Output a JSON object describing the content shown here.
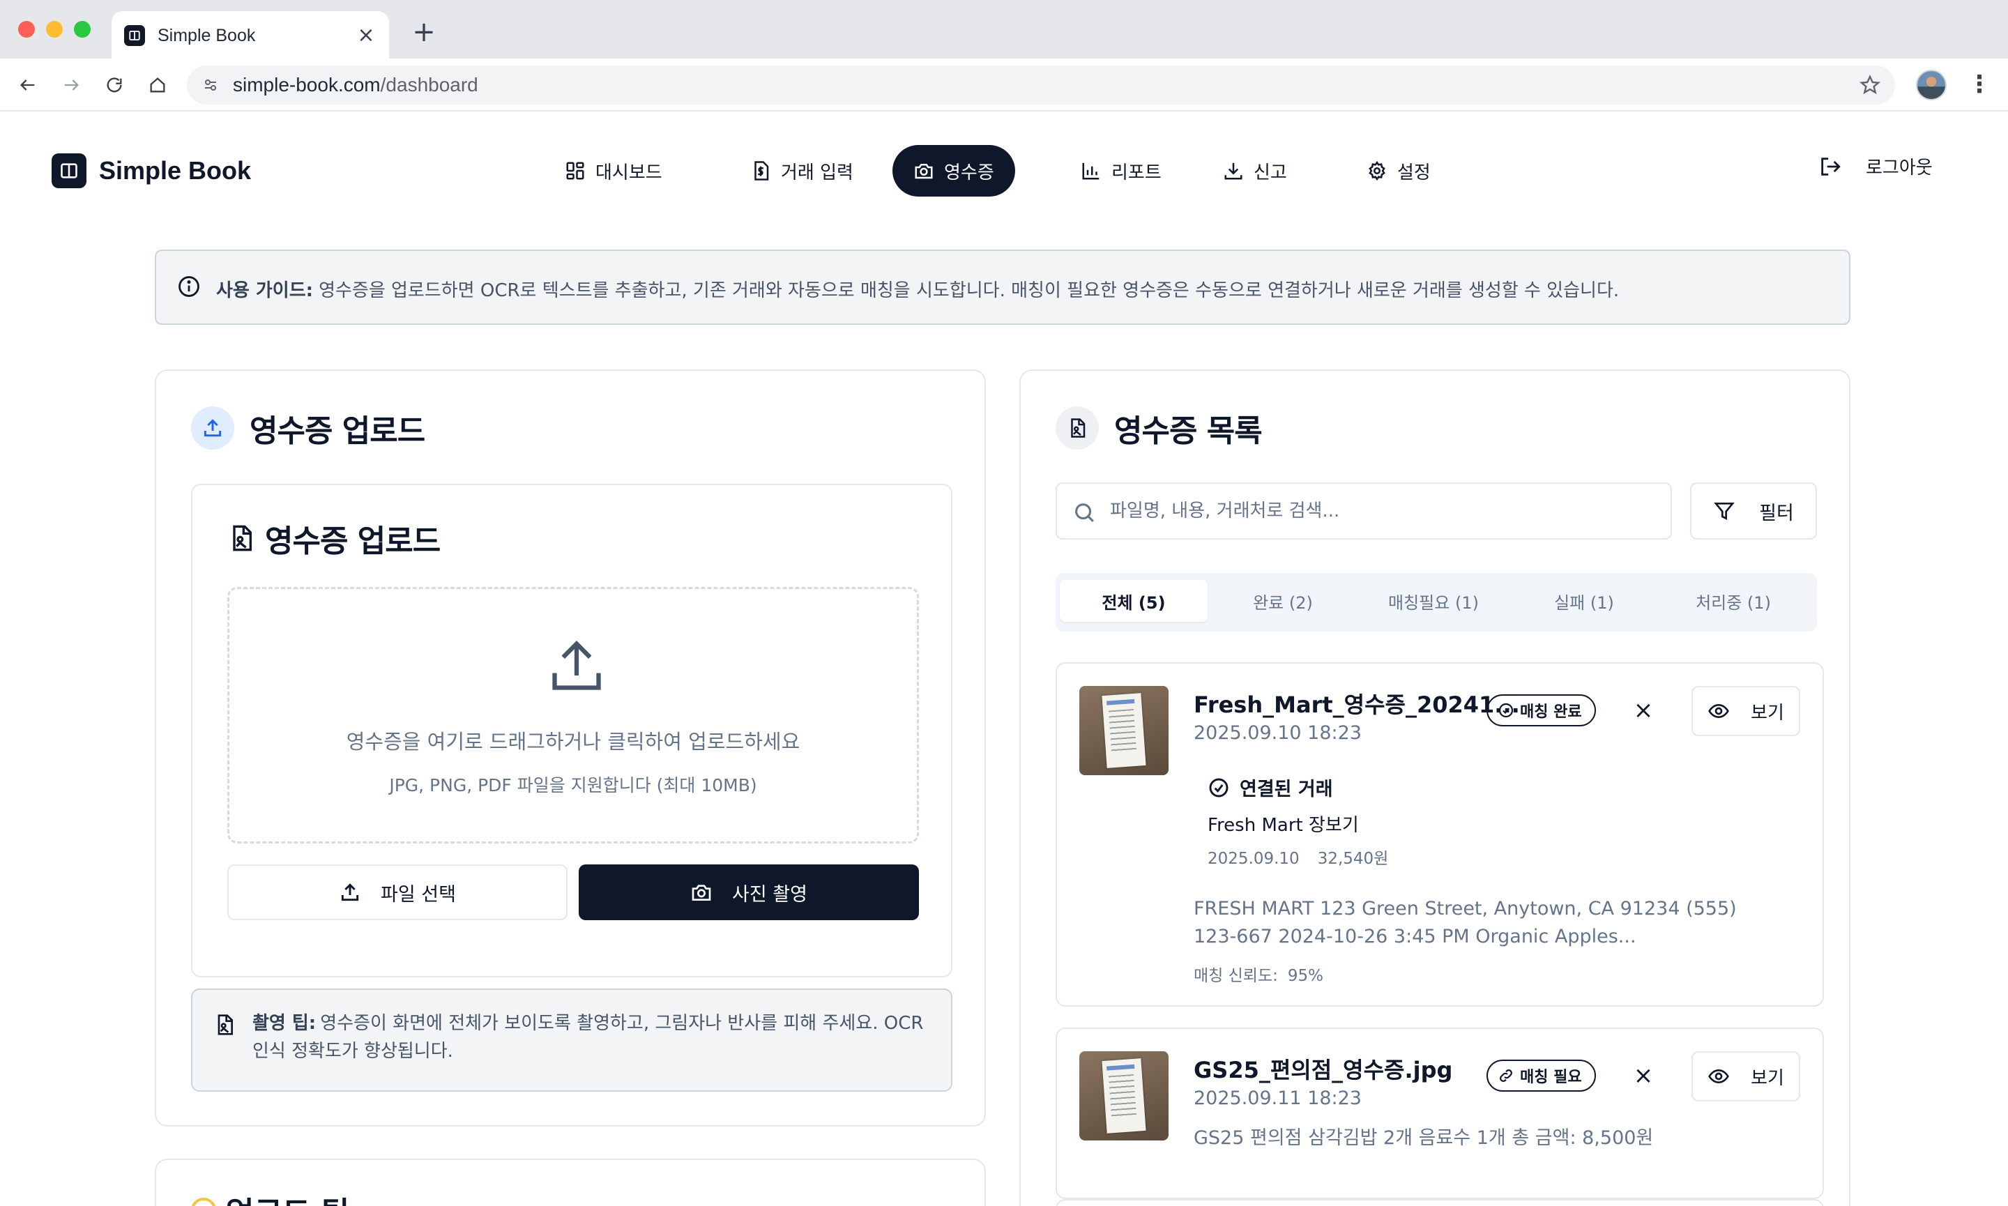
{
  "browser": {
    "tab_title": "Simple Book",
    "url_host": "simple-book.com",
    "url_path": "/dashboard"
  },
  "app": {
    "logo_text": "Simple Book",
    "nav": [
      {
        "label": "대시보드",
        "icon": "dashboard-icon"
      },
      {
        "label": "거래 입력",
        "icon": "dollar-file-icon"
      },
      {
        "label": "영수증",
        "icon": "camera-icon",
        "active": true
      },
      {
        "label": "리포트",
        "icon": "bar-chart-icon"
      },
      {
        "label": "신고",
        "icon": "download-icon"
      },
      {
        "label": "설정",
        "icon": "gear-icon"
      }
    ],
    "logout_label": "로그아웃"
  },
  "guide": {
    "label": "사용 가이드:",
    "text": "영수증을 업로드하면 OCR로 텍스트를 추출하고, 기존 거래와 자동으로 매칭을 시도합니다. 매칭이 필요한 영수증은 수동으로 연결하거나 새로운 거래를 생성할 수 있습니다."
  },
  "upload": {
    "section_title": "영수증 업로드",
    "inner_title": "영수증 업로드",
    "drop_main": "영수증을 여기로 드래그하거나 클릭하여 업로드하세요",
    "drop_sub": "JPG, PNG, PDF 파일을 지원합니다 (최대 10MB)",
    "file_button": "파일 선택",
    "photo_button": "사진 촬영",
    "tip_label": "촬영 팁:",
    "tip_text": "영수증이 화면에 전체가 보이도록 촬영하고, 그림자나 반사를 피해 주세요. OCR 인식 정확도가 향상됩니다."
  },
  "upload_tips": {
    "title": "업로드 팁"
  },
  "receipts": {
    "section_title": "영수증 목록",
    "search_placeholder": "파일명, 내용, 거래처로 검색...",
    "filter_label": "필터",
    "tabs": [
      "전체 (5)",
      "완료 (2)",
      "매칭필요 (1)",
      "실패 (1)",
      "처리중 (1)"
    ],
    "items": [
      {
        "name": "Fresh_Mart_영수증_20241...",
        "date": "2025.09.10 18:23",
        "badge": "매칭 완료",
        "view_label": "보기",
        "linked_label": "연결된 거래",
        "linked_title": "Fresh Mart 장보기",
        "linked_date": "2025.09.10",
        "linked_amount": "32,540원",
        "ocr_text": "FRESH MART 123 Green Street, Anytown, CA 91234 (555) 123-667 2024-10-26 3:45 PM Organic Apples...",
        "confidence_label": "매칭 신뢰도:",
        "confidence_value": "95%"
      },
      {
        "name": "GS25_편의점_영수증.jpg",
        "date": "2025.09.11 18:23",
        "badge": "매칭 필요",
        "view_label": "보기",
        "ocr_text": "GS25 편의점 삼각김밥 2개 음료수 1개 총 금액: 8,500원"
      }
    ]
  }
}
